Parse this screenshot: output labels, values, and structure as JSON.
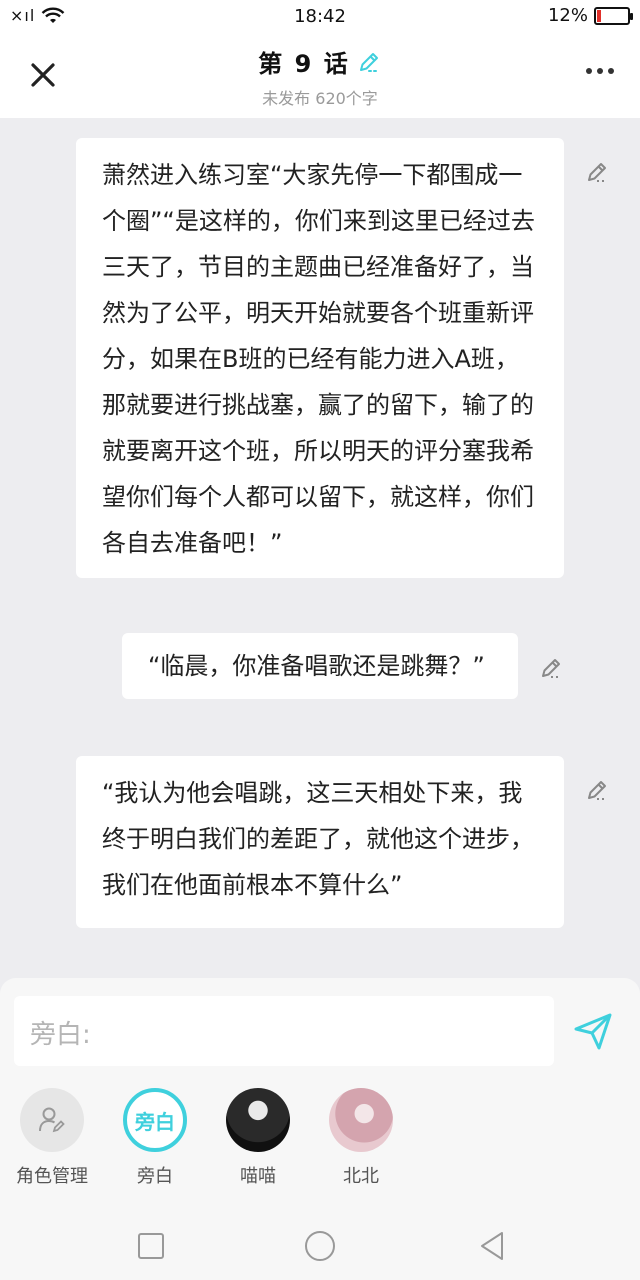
{
  "status_bar": {
    "time": "18:42",
    "battery_percent_text": "12%",
    "battery_level": 0.12,
    "signal_text": "×ıl"
  },
  "header": {
    "title": "第 9 话",
    "subtitle": "未发布 620个字",
    "icons": [
      "close-icon",
      "pencil-icon",
      "more-icon"
    ]
  },
  "messages": [
    {
      "text": "萧然进入练习室“大家先停一下都围成一个圈”“是这样的，你们来到这里已经过去三天了，节目的主题曲已经准备好了，当然为了公平，明天开始就要各个班重新评分，如果在B班的已经有能力进入A班，那就要进行挑战塞，赢了的留下，输了的就要离开这个班，所以明天的评分塞我希望你们每个人都可以留下，就这样，你们各自去准备吧！”"
    },
    {
      "text": "“临晨，你准备唱歌还是跳舞？”"
    },
    {
      "text": "“我认为他会唱跳，这三天相处下来，我终于明白我们的差距了，就他这个进步，我们在他面前根本不算什么”"
    }
  ],
  "composer": {
    "placeholder": "旁白:",
    "send_icon": "send-icon"
  },
  "roles": [
    {
      "label": "角色管理",
      "avatar_text": "",
      "icon": "user-edit-icon"
    },
    {
      "label": "旁白",
      "avatar_text": "旁白",
      "selected": true
    },
    {
      "label": "喵喵",
      "avatar_text": ""
    },
    {
      "label": "北北",
      "avatar_text": ""
    }
  ],
  "colors": {
    "accent": "#3fd0dd",
    "background": "#ededf0",
    "battery_low": "#e0302a"
  }
}
